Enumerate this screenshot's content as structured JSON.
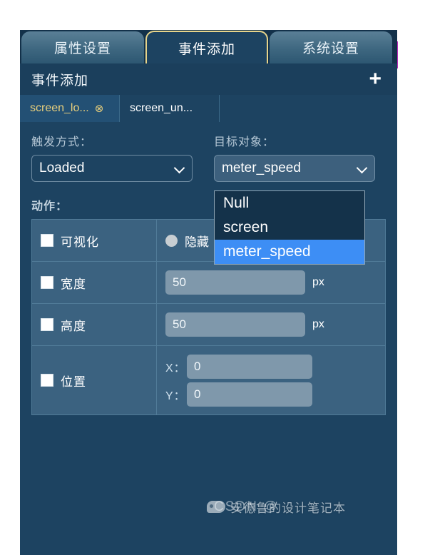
{
  "tabs": [
    {
      "label": "属性设置",
      "active": false
    },
    {
      "label": "事件添加",
      "active": true
    },
    {
      "label": "系统设置",
      "active": false
    }
  ],
  "panel_header": {
    "title": "事件添加",
    "add_icon": "+"
  },
  "subtabs": [
    {
      "label": "screen_lo...",
      "close_icon": "⊗",
      "active": true
    },
    {
      "label": "screen_un...",
      "active": false
    }
  ],
  "fields": {
    "trigger": {
      "label": "触发方式：",
      "value": "Loaded"
    },
    "target": {
      "label": "目标对象：",
      "value": "meter_speed",
      "options": [
        "Null",
        "screen",
        "meter_speed"
      ],
      "selected": "meter_speed",
      "open": true
    }
  },
  "action": {
    "label": "动作：",
    "rows": [
      {
        "name": "可视化",
        "checked": false,
        "control": "radio",
        "radio_label": "隐藏"
      },
      {
        "name": "宽度",
        "checked": false,
        "control": "number",
        "value": "50",
        "unit": "px"
      },
      {
        "name": "高度",
        "checked": false,
        "control": "number",
        "value": "50",
        "unit": "px"
      },
      {
        "name": "位置",
        "checked": false,
        "control": "xy",
        "x_label": "X：",
        "x_value": "0",
        "y_label": "Y：",
        "y_value": "0"
      }
    ]
  },
  "watermark": {
    "brand": "CSDN @",
    "author": "安德鲁的设计笔记本"
  },
  "colors": {
    "panel_bg": "#1d4361",
    "tabbar_bg": "#13314a",
    "active_tab_border": "#e7d48a",
    "subtab_active_text": "#e8cf7c",
    "dropdown_highlight": "#3d8ef5",
    "table_cell": "#3b6280",
    "input_bg": "#7f98ab",
    "sliver": "#b329b7"
  }
}
